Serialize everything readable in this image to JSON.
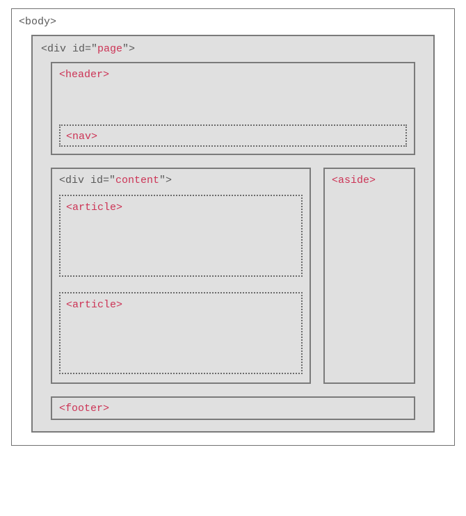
{
  "diagram": {
    "body_tag": "<body>",
    "page_label_prefix": "<div id=\"",
    "page_id": "page",
    "page_label_suffix": "\">",
    "header_tag": "<header>",
    "nav_tag": "<nav>",
    "content_label_prefix": "<div id=\"",
    "content_id": "content",
    "content_label_suffix": "\">",
    "article_tag_1": "<article>",
    "article_tag_2": "<article>",
    "aside_tag": "<aside>",
    "footer_tag": "<footer>"
  }
}
